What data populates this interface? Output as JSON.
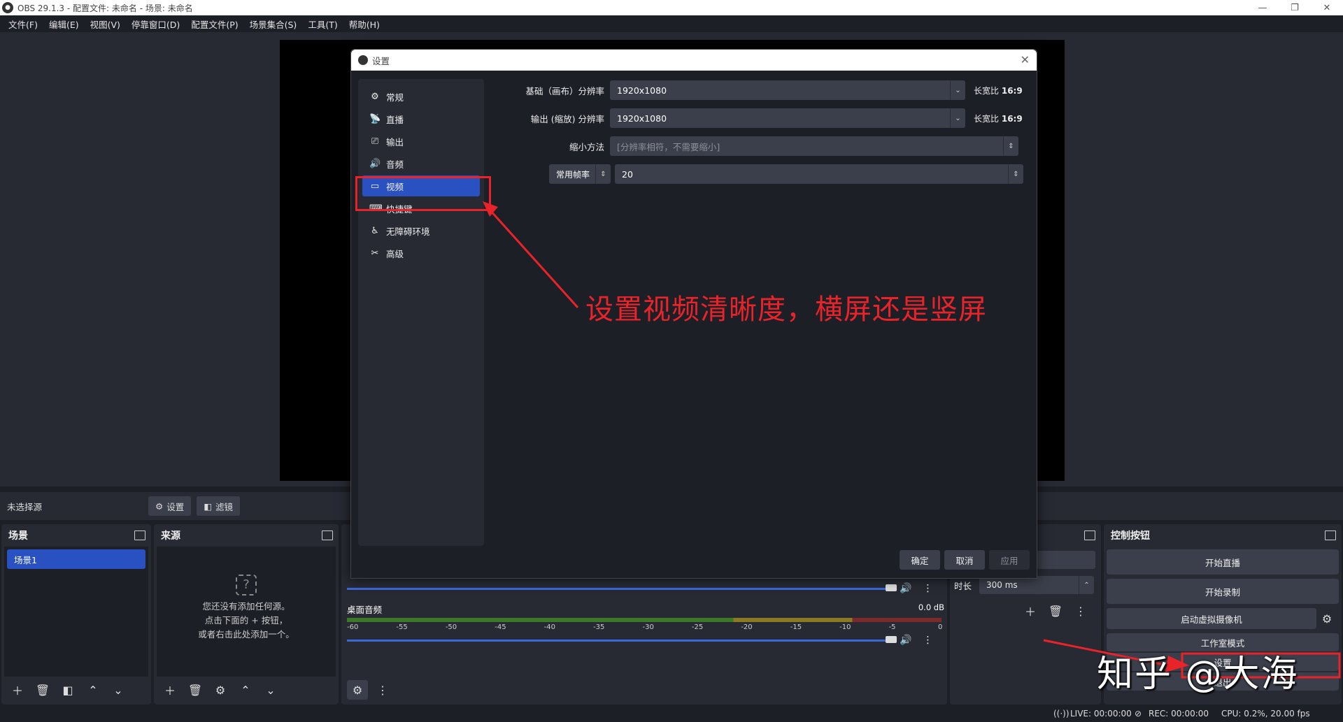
{
  "window": {
    "title": "OBS 29.1.3 - 配置文件: 未命名 - 场景: 未命名"
  },
  "menu": [
    "文件(F)",
    "编辑(E)",
    "视图(V)",
    "停靠窗口(D)",
    "配置文件(P)",
    "场景集合(S)",
    "工具(T)",
    "帮助(H)"
  ],
  "source_bar": {
    "no_source": "未选择源",
    "settings": "设置",
    "filters": "滤镜"
  },
  "scenes": {
    "title": "场景",
    "items": [
      "场景1"
    ]
  },
  "sources": {
    "title": "来源",
    "empty_line1": "您还没有添加任何源。",
    "empty_line2": "点击下面的 + 按钮，",
    "empty_line3": "或者右击此处添加一个。"
  },
  "mixer": {
    "desktop_audio": "桌面音频",
    "desktop_db": "0.0 dB",
    "ticks": [
      "-60",
      "-55",
      "-50",
      "-45",
      "-40",
      "-35",
      "-30",
      "-25",
      "-20",
      "-15",
      "-10",
      "-5",
      "0"
    ]
  },
  "transitions": {
    "duration_label": "时长",
    "duration_value": "300 ms"
  },
  "controls": {
    "title": "控制按钮",
    "start_stream": "开始直播",
    "start_record": "开始录制",
    "virtual_cam": "启动虚拟摄像机",
    "studio_mode": "工作室模式",
    "settings": "设置",
    "exit": "退出"
  },
  "status": {
    "live": "LIVE: 00:00:00",
    "rec": "REC: 00:00:00",
    "cpu": "CPU: 0.2%, 20.00 fps"
  },
  "settings_dialog": {
    "title": "设置",
    "nav": [
      {
        "label": "常规",
        "icon": "gear-icon"
      },
      {
        "label": "直播",
        "icon": "antenna-icon"
      },
      {
        "label": "输出",
        "icon": "monitor-output-icon"
      },
      {
        "label": "音频",
        "icon": "speaker-icon"
      },
      {
        "label": "视频",
        "icon": "video-monitor-icon"
      },
      {
        "label": "快捷键",
        "icon": "keyboard-icon"
      },
      {
        "label": "无障碍环境",
        "icon": "accessibility-icon"
      },
      {
        "label": "高级",
        "icon": "tools-icon"
      }
    ],
    "base_res_label": "基础（画布）分辨率",
    "base_res_value": "1920x1080",
    "base_ratio_label": "长宽比",
    "base_ratio_value": "16:9",
    "output_res_label": "输出 (缩放) 分辨率",
    "output_res_value": "1920x1080",
    "output_ratio_label": "长宽比",
    "output_ratio_value": "16:9",
    "downscale_label": "缩小方法",
    "downscale_value": "[分辨率相符，不需要缩小]",
    "fps_type": "常用帧率",
    "fps_value": "20",
    "ok": "确定",
    "cancel": "取消",
    "apply": "应用"
  },
  "annotation": "设置视频清晰度，横屏还是竖屏",
  "watermark": "知乎 @大海",
  "colors": {
    "accent": "#2a51c2",
    "annotation_red": "#e8232a"
  }
}
